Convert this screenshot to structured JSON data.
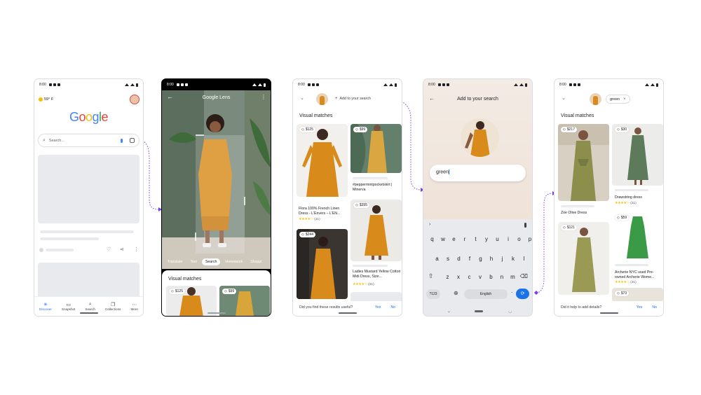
{
  "screens": {
    "home": {
      "status_time": "8:00",
      "weather": "59° F",
      "logo": "Google",
      "search_placeholder": "Search...",
      "nav": [
        "Discover",
        "Snapshot",
        "Search",
        "Collections",
        "More"
      ]
    },
    "lens": {
      "status_time": "8:00",
      "title": "Google Lens",
      "modes": [
        "Translate",
        "Text",
        "Search",
        "Homework",
        "Shoppi"
      ],
      "active_mode": "Search",
      "section_title": "Visual matches",
      "prices": [
        "$125",
        "$99"
      ]
    },
    "results": {
      "status_time": "8:00",
      "add_label": "Add to your search",
      "section_title": "Visual matches",
      "items": [
        {
          "price": "$125",
          "caption": "Flora 100% French Linen Dress - L'Envers – L'EN...",
          "stars": "★★★★☆",
          "rating": "(31)"
        },
        {
          "price": "$99",
          "caption": "#peppermintpocketskirt | Minerva"
        },
        {
          "price": "$395",
          "caption": "Ladies Mustard Yellow Cotton Midi Dress, Size...",
          "stars": "★★★★☆",
          "rating": "(31)"
        },
        {
          "price": "$244"
        }
      ],
      "question": "Did you find these results useful?",
      "yes": "Yes",
      "no": "No"
    },
    "keyboard": {
      "status_time": "8:00",
      "title": "Add to your search",
      "query": "green",
      "row1": [
        "q",
        "w",
        "e",
        "r",
        "t",
        "y",
        "u",
        "i",
        "o",
        "p"
      ],
      "row2": [
        "a",
        "s",
        "d",
        "f",
        "g",
        "h",
        "j",
        "k",
        "l"
      ],
      "row3": [
        "z",
        "x",
        "c",
        "v",
        "b",
        "n",
        "m"
      ],
      "symbols_key": "?123",
      "space_key": "English",
      "period_key": "."
    },
    "refined": {
      "status_time": "8:00",
      "chip": "green",
      "section_title": "Visual matches",
      "items": [
        {
          "price": "$217",
          "caption": "Zoe Olive Dress"
        },
        {
          "price": "$30",
          "caption": "Drawstring dress",
          "stars": "★★★★☆",
          "rating": "(31)"
        },
        {
          "price": "$121"
        },
        {
          "price": "$59",
          "caption": "Archerie NYC used Pre-owned Archerie Wome...",
          "stars": "★★★★☆",
          "rating": "(31)"
        },
        {
          "price": "$73"
        }
      ],
      "question": "Did it help to add details?",
      "yes": "Yes",
      "no": "No"
    }
  },
  "colors": {
    "accent": "#1a73e8",
    "connector": "#7b3fe4",
    "mustard": "#d88a1a",
    "olive": "#8c8f4c",
    "green_dress": "#3a9a46",
    "sage": "#5d7a5a"
  },
  "icons": [
    "search-icon",
    "mic-icon",
    "lens-icon",
    "back-arrow-icon",
    "more-vert-icon",
    "heart-icon",
    "share-icon",
    "tag-icon",
    "close-icon",
    "chevron-down-icon",
    "backspace-icon",
    "shift-icon",
    "globe-icon",
    "emoji-icon"
  ]
}
